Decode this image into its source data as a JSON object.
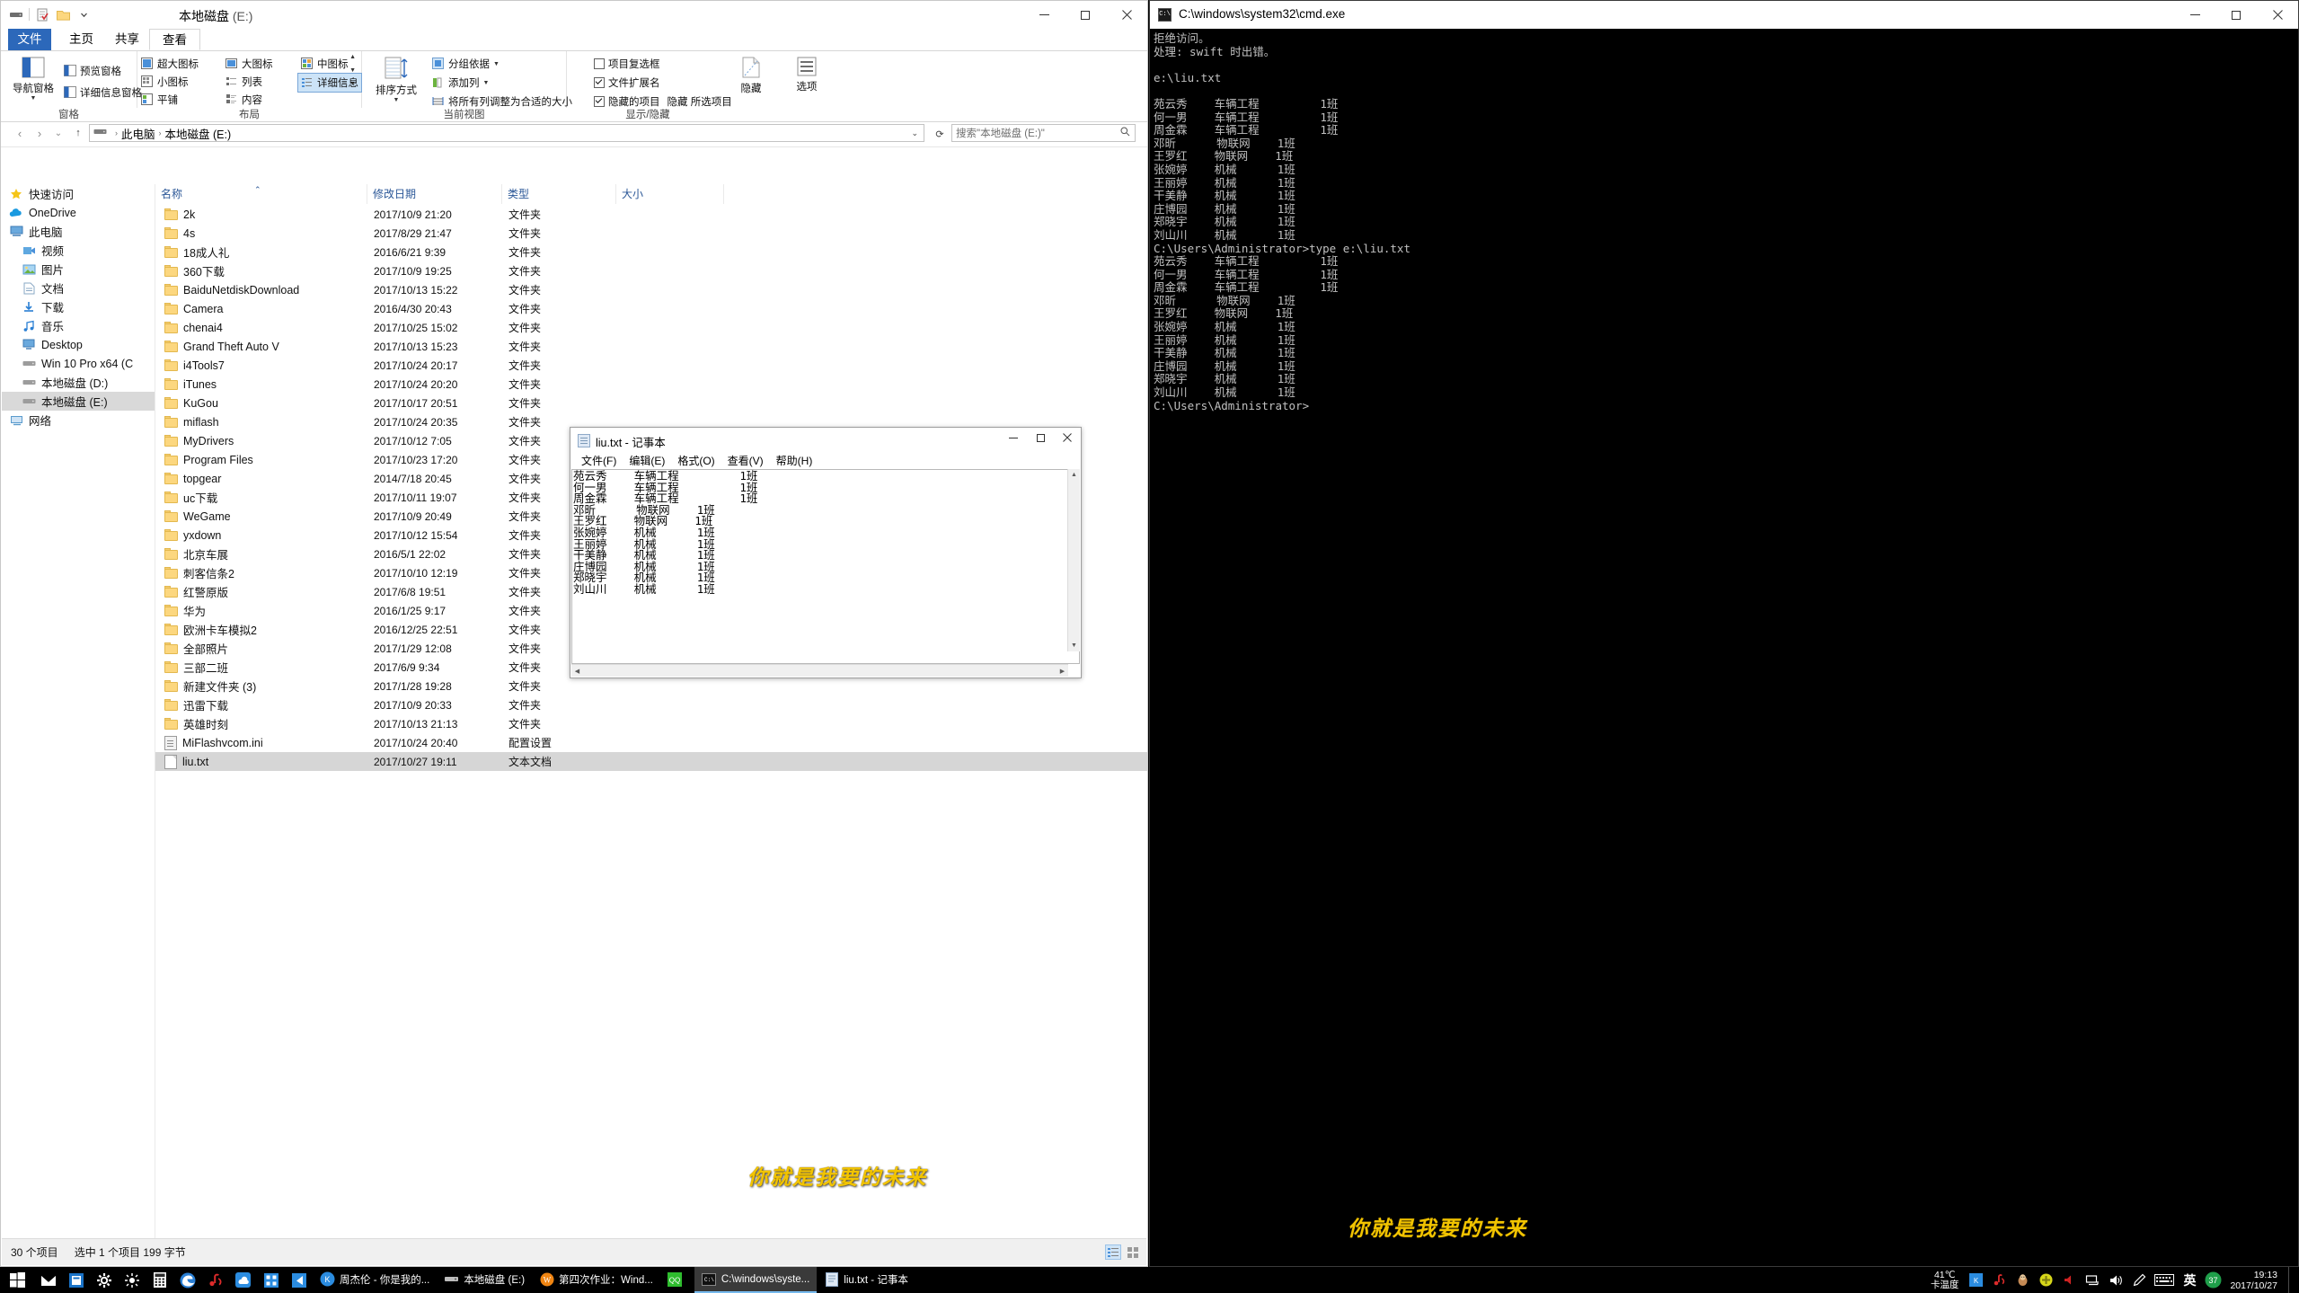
{
  "explorer": {
    "title_main": "本地磁盘",
    "title_drive": "(E:)",
    "quick_access_icons": [
      "drive-icon",
      "properties-icon",
      "new-folder-icon",
      "qat-dropdown-icon"
    ],
    "tabs": [
      {
        "label": "文件",
        "name": "tab-file"
      },
      {
        "label": "主页",
        "name": "tab-home"
      },
      {
        "label": "共享",
        "name": "tab-share"
      },
      {
        "label": "查看",
        "name": "tab-view"
      }
    ],
    "ribbon": {
      "groups": [
        {
          "label": "窗格"
        },
        {
          "label": "布局"
        },
        {
          "label": "当前视图"
        },
        {
          "label": "显示/隐藏"
        }
      ],
      "panes": {
        "nav_pane": "导航窗格",
        "preview_pane": "预览窗格",
        "details_pane": "详细信息窗格"
      },
      "layout": {
        "extra_large": "超大图标",
        "large": "大图标",
        "medium": "中图标",
        "small": "小图标",
        "list": "列表",
        "details": "详细信息",
        "tiles": "平铺",
        "content": "内容"
      },
      "current_view": {
        "sort_by": "排序方式",
        "group_by": "分组依据",
        "add_columns": "添加列",
        "size_all_columns": "将所有列调整为合适的大小"
      },
      "show_hide": {
        "item_checkboxes": "项目复选框",
        "file_name_extensions": "文件扩展名",
        "hidden_items": "隐藏的项目",
        "hide_selected": "隐藏 所选项目",
        "hide_btn": "隐藏",
        "options": "选项"
      },
      "checked": {
        "item_checkboxes": false,
        "file_name_extensions": true,
        "hidden_items": true
      }
    },
    "address": {
      "breadcrumb": [
        "此电脑",
        "本地磁盘 (E:)"
      ],
      "search_placeholder": "搜索\"本地磁盘 (E:)\"",
      "back_icon": "arrow-left-icon",
      "forward_icon": "arrow-right-icon",
      "up_icon": "arrow-up-icon",
      "refresh_icon": "refresh-icon",
      "history_icon": "chevron-down-icon",
      "search_icon": "search-icon"
    },
    "nav_pane": [
      {
        "label": "快速访问",
        "icon": "star-icon",
        "selected": false
      },
      {
        "label": "OneDrive",
        "icon": "cloud-icon",
        "selected": false
      },
      {
        "label": "此电脑",
        "icon": "pc-icon",
        "selected": false
      },
      {
        "label": "视频",
        "icon": "video-icon",
        "selected": false,
        "indent": 1
      },
      {
        "label": "图片",
        "icon": "picture-icon",
        "selected": false,
        "indent": 1
      },
      {
        "label": "文档",
        "icon": "document-icon",
        "selected": false,
        "indent": 1
      },
      {
        "label": "下载",
        "icon": "download-icon",
        "selected": false,
        "indent": 1
      },
      {
        "label": "音乐",
        "icon": "music-icon",
        "selected": false,
        "indent": 1
      },
      {
        "label": "Desktop",
        "icon": "desktop-icon",
        "selected": false,
        "indent": 1
      },
      {
        "label": "Win 10 Pro x64 (C",
        "icon": "disk-icon",
        "selected": false,
        "indent": 1
      },
      {
        "label": "本地磁盘 (D:)",
        "icon": "disk-icon",
        "selected": false,
        "indent": 1
      },
      {
        "label": "本地磁盘 (E:)",
        "icon": "disk-icon",
        "selected": true,
        "indent": 1
      },
      {
        "label": "网络",
        "icon": "network-icon",
        "selected": false
      }
    ],
    "columns": [
      {
        "label": "名称",
        "name": "column-name"
      },
      {
        "label": "修改日期",
        "name": "column-date"
      },
      {
        "label": "类型",
        "name": "column-type"
      },
      {
        "label": "大小",
        "name": "column-size"
      }
    ],
    "sort_indicator": "ascending-caret-icon",
    "files": [
      {
        "name": "2k",
        "date": "2017/10/9 21:20",
        "type": "文件夹",
        "size": "",
        "icon": "folder-icon",
        "selected": false
      },
      {
        "name": "4s",
        "date": "2017/8/29 21:47",
        "type": "文件夹",
        "size": "",
        "icon": "folder-icon",
        "selected": false
      },
      {
        "name": "18成人礼",
        "date": "2016/6/21 9:39",
        "type": "文件夹",
        "size": "",
        "icon": "folder-icon",
        "selected": false
      },
      {
        "name": "360下载",
        "date": "2017/10/9 19:25",
        "type": "文件夹",
        "size": "",
        "icon": "folder-icon",
        "selected": false
      },
      {
        "name": "BaiduNetdiskDownload",
        "date": "2017/10/13 15:22",
        "type": "文件夹",
        "size": "",
        "icon": "folder-icon",
        "selected": false
      },
      {
        "name": "Camera",
        "date": "2016/4/30 20:43",
        "type": "文件夹",
        "size": "",
        "icon": "folder-icon",
        "selected": false
      },
      {
        "name": "chenai4",
        "date": "2017/10/25 15:02",
        "type": "文件夹",
        "size": "",
        "icon": "folder-icon",
        "selected": false
      },
      {
        "name": "Grand Theft Auto V",
        "date": "2017/10/13 15:23",
        "type": "文件夹",
        "size": "",
        "icon": "folder-icon",
        "selected": false
      },
      {
        "name": "i4Tools7",
        "date": "2017/10/24 20:17",
        "type": "文件夹",
        "size": "",
        "icon": "folder-icon",
        "selected": false
      },
      {
        "name": "iTunes",
        "date": "2017/10/24 20:20",
        "type": "文件夹",
        "size": "",
        "icon": "folder-icon",
        "selected": false
      },
      {
        "name": "KuGou",
        "date": "2017/10/17 20:51",
        "type": "文件夹",
        "size": "",
        "icon": "folder-icon",
        "selected": false
      },
      {
        "name": "miflash",
        "date": "2017/10/24 20:35",
        "type": "文件夹",
        "size": "",
        "icon": "folder-icon",
        "selected": false
      },
      {
        "name": "MyDrivers",
        "date": "2017/10/12 7:05",
        "type": "文件夹",
        "size": "",
        "icon": "folder-icon",
        "selected": false
      },
      {
        "name": "Program Files",
        "date": "2017/10/23 17:20",
        "type": "文件夹",
        "size": "",
        "icon": "folder-icon",
        "selected": false
      },
      {
        "name": "topgear",
        "date": "2014/7/18 20:45",
        "type": "文件夹",
        "size": "",
        "icon": "folder-icon",
        "selected": false
      },
      {
        "name": "uc下载",
        "date": "2017/10/11 19:07",
        "type": "文件夹",
        "size": "",
        "icon": "folder-icon",
        "selected": false
      },
      {
        "name": "WeGame",
        "date": "2017/10/9 20:49",
        "type": "文件夹",
        "size": "",
        "icon": "folder-icon",
        "selected": false
      },
      {
        "name": "yxdown",
        "date": "2017/10/12 15:54",
        "type": "文件夹",
        "size": "",
        "icon": "folder-icon",
        "selected": false
      },
      {
        "name": "北京车展",
        "date": "2016/5/1 22:02",
        "type": "文件夹",
        "size": "",
        "icon": "folder-icon",
        "selected": false
      },
      {
        "name": "刺客信条2",
        "date": "2017/10/10 12:19",
        "type": "文件夹",
        "size": "",
        "icon": "folder-icon",
        "selected": false
      },
      {
        "name": "红警原版",
        "date": "2017/6/8 19:51",
        "type": "文件夹",
        "size": "",
        "icon": "folder-icon",
        "selected": false
      },
      {
        "name": "华为",
        "date": "2016/1/25 9:17",
        "type": "文件夹",
        "size": "",
        "icon": "folder-icon",
        "selected": false
      },
      {
        "name": "欧洲卡车模拟2",
        "date": "2016/12/25 22:51",
        "type": "文件夹",
        "size": "",
        "icon": "folder-icon",
        "selected": false
      },
      {
        "name": "全部照片",
        "date": "2017/1/29 12:08",
        "type": "文件夹",
        "size": "",
        "icon": "folder-icon",
        "selected": false
      },
      {
        "name": "三部二班",
        "date": "2017/6/9 9:34",
        "type": "文件夹",
        "size": "",
        "icon": "folder-icon",
        "selected": false
      },
      {
        "name": "新建文件夹 (3)",
        "date": "2017/1/28 19:28",
        "type": "文件夹",
        "size": "",
        "icon": "folder-icon",
        "selected": false
      },
      {
        "name": "迅雷下载",
        "date": "2017/10/9 20:33",
        "type": "文件夹",
        "size": "",
        "icon": "folder-icon",
        "selected": false
      },
      {
        "name": "英雄时刻",
        "date": "2017/10/13 21:13",
        "type": "文件夹",
        "size": "",
        "icon": "folder-icon",
        "selected": false
      },
      {
        "name": "MiFlashvcom.ini",
        "date": "2017/10/24 20:40",
        "type": "配置设置",
        "size": "",
        "icon": "config-icon",
        "selected": false
      },
      {
        "name": "liu.txt",
        "date": "2017/10/27 19:11",
        "type": "文本文档",
        "size": "",
        "icon": "text-file-icon",
        "selected": true
      }
    ],
    "status": {
      "count": "30 个项目",
      "selection": "选中 1 个项目  199 字节",
      "view_details_icon": "details-view-icon",
      "view_tiles_icon": "large-icons-view-icon"
    }
  },
  "cmd": {
    "title": "C:\\windows\\system32\\cmd.exe",
    "icon": "console-icon",
    "output": "拒绝访问。\n处理: swift 时出错。\n\ne:\\liu.txt\n\n苑云秀    车辆工程         1班\n何一男    车辆工程         1班\n周金霖    车辆工程         1班\n邓昕      物联网    1班\n王罗红    物联网    1班\n张婉婷    机械      1班\n王丽婷    机械      1班\n干美静    机械      1班\n庄博园    机械      1班\n郑晓宇    机械      1班\n刘山川    机械      1班\nC:\\Users\\Administrator>type e:\\liu.txt\n苑云秀    车辆工程         1班\n何一男    车辆工程         1班\n周金霖    车辆工程         1班\n邓昕      物联网    1班\n王罗红    物联网    1班\n张婉婷    机械      1班\n王丽婷    机械      1班\n干美静    机械      1班\n庄博园    机械      1班\n郑晓宇    机械      1班\n刘山川    机械      1班\nC:\\Users\\Administrator>"
  },
  "notepad": {
    "title": "liu.txt - 记事本",
    "icon": "notepad-icon",
    "menus": [
      "文件(F)",
      "编辑(E)",
      "格式(O)",
      "查看(V)",
      "帮助(H)"
    ],
    "window_buttons": {
      "minimize": "–",
      "maximize": "☐",
      "close": "✕"
    },
    "content": "苑云秀    车辆工程         1班\n何一男    车辆工程         1班\n周金霖    车辆工程         1班\n邓昕      物联网    1班\n王罗红    物联网    1班\n张婉婷    机械      1班\n王丽婷    机械      1班\n干美静    机械      1班\n庄博园    机械      1班\n郑晓宇    机械      1班\n刘山川    机械      1班"
  },
  "overlay": {
    "lyric_left": "你就是我要的未来",
    "lyric_right": "你就是我要的未来",
    "color": "#f2c400"
  },
  "taskbar": {
    "start_icon": "windows-start-icon",
    "pinned": [
      {
        "name": "mail-icon"
      },
      {
        "name": "store-icon"
      },
      {
        "name": "settings-gear-icon"
      },
      {
        "name": "brightness-icon"
      },
      {
        "name": "calculator-icon"
      },
      {
        "name": "edge-icon"
      },
      {
        "name": "netease-music-icon"
      },
      {
        "name": "baidu-netdisk-icon"
      },
      {
        "name": "tencent-video-icon"
      },
      {
        "name": "wechat-icon"
      }
    ],
    "tasks": [
      {
        "label": "周杰伦 - 你是我的...",
        "icon": "kugou-icon",
        "active": false
      },
      {
        "label": "本地磁盘 (E:)",
        "icon": "explorer-icon",
        "active": false
      },
      {
        "label": "第四次作业：Wind...",
        "icon": "wps-icon",
        "active": false
      },
      {
        "label": "",
        "icon": "green-app-icon",
        "active": false
      },
      {
        "label": "C:\\windows\\syste...",
        "icon": "cmd-icon",
        "active": true
      },
      {
        "label": "liu.txt - 记事本",
        "icon": "notepad-icon",
        "active": false
      }
    ],
    "tray": {
      "temperature_value": "41℃",
      "temperature_label": "卡温度",
      "icons": [
        "kingsoft-icon",
        "netease-cloud-icon",
        "qq-pinyin-icon",
        "360-shield-icon",
        "volume-red-icon",
        "network-icon",
        "speaker-icon",
        "pen-icon",
        "keyboard-icon",
        "ime-chinese-icon",
        "green-37-badge-icon"
      ],
      "ime_label": "英",
      "badge_number": "37"
    },
    "clock": {
      "time": "19:13",
      "date": "2017/10/27"
    },
    "show_desktop": "show-desktop-button"
  }
}
